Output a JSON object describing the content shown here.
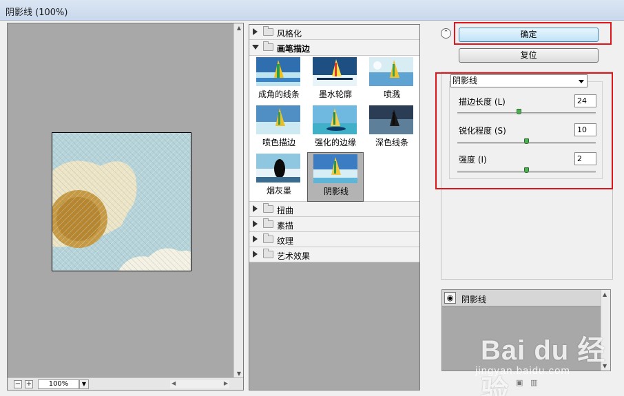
{
  "window": {
    "title": "阴影线 (100%)"
  },
  "preview": {
    "zoom_minus": "−",
    "zoom_plus": "+",
    "zoom_value": "100%",
    "zoom_dropdown_icon": "triangle-down"
  },
  "filter_gallery": {
    "categories_top": [
      {
        "label": "风格化",
        "expanded": false
      },
      {
        "label": "画笔描边",
        "expanded": true
      }
    ],
    "thumbnails": [
      {
        "label": "成角的线条"
      },
      {
        "label": "墨水轮廓"
      },
      {
        "label": "喷溅"
      },
      {
        "label": "喷色描边"
      },
      {
        "label": "强化的边缘"
      },
      {
        "label": "深色线条"
      },
      {
        "label": "烟灰墨"
      },
      {
        "label": "阴影线",
        "selected": true
      }
    ],
    "categories_bottom": [
      {
        "label": "扭曲"
      },
      {
        "label": "素描"
      },
      {
        "label": "纹理"
      },
      {
        "label": "艺术效果"
      }
    ]
  },
  "buttons": {
    "ok": "确定",
    "reset": "复位"
  },
  "settings": {
    "selected_filter": "阴影线",
    "params": [
      {
        "label": "描边长度 (L)",
        "value": "24",
        "fraction": 0.45
      },
      {
        "label": "锐化程度 (S)",
        "value": "10",
        "fraction": 0.5
      },
      {
        "label": "强度 (I)",
        "value": "2",
        "fraction": 0.5
      }
    ]
  },
  "layers": {
    "items": [
      {
        "name": "阴影线",
        "visible": true
      }
    ]
  },
  "watermark": {
    "brand": "Bai du 经验",
    "url": "jingyan.baidu.com"
  },
  "colors": {
    "highlight_box": "#e0151b",
    "slider_thumb": "#4caf50",
    "ok_button": "#bfe3f7"
  }
}
